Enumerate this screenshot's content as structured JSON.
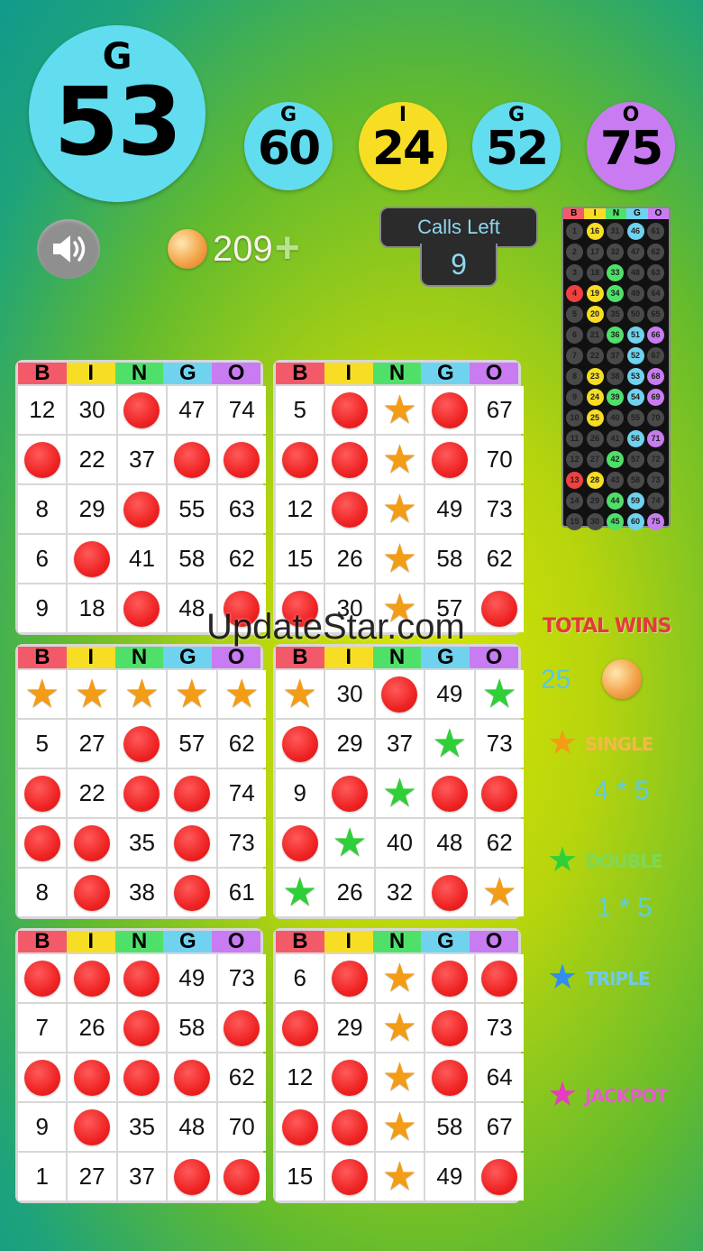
{
  "current_call": {
    "letter": "G",
    "number": "53",
    "color": "#62ddf0"
  },
  "previous_calls": [
    {
      "letter": "G",
      "number": "60",
      "color": "#62ddf0"
    },
    {
      "letter": "I",
      "number": "24",
      "color": "#f7de25"
    },
    {
      "letter": "G",
      "number": "52",
      "color": "#62ddf0"
    },
    {
      "letter": "O",
      "number": "75",
      "color": "#c97cf2"
    }
  ],
  "coins": {
    "count": "209",
    "add_symbol": "+"
  },
  "calls_left": {
    "label": "Calls Left",
    "value": "9"
  },
  "column_letters": [
    "B",
    "I",
    "N",
    "G",
    "O"
  ],
  "column_colors": [
    "#f25a6a",
    "#f7de25",
    "#4fe06a",
    "#6fd3ef",
    "#c97cf2"
  ],
  "tracker": {
    "header": [
      "B",
      "I",
      "N",
      "G",
      "O"
    ],
    "called": {
      "1": "#4a4a4a",
      "4": "#f04040",
      "13": "#f04040",
      "16": "#f7de25",
      "19": "#f7de25",
      "20": "#f7de25",
      "23": "#f7de25",
      "24": "#f7de25",
      "25": "#f7de25",
      "28": "#f7de25",
      "33": "#4fe06a",
      "34": "#4fe06a",
      "36": "#4fe06a",
      "39": "#4fe06a",
      "42": "#4fe06a",
      "44": "#4fe06a",
      "45": "#4fe06a",
      "46": "#6fd3ef",
      "51": "#6fd3ef",
      "52": "#6fd3ef",
      "53": "#6fd3ef",
      "54": "#6fd3ef",
      "56": "#6fd3ef",
      "59": "#6fd3ef",
      "60": "#6fd3ef",
      "66": "#c97cf2",
      "68": "#c97cf2",
      "69": "#c97cf2",
      "71": "#c97cf2",
      "75": "#c97cf2"
    }
  },
  "cards": [
    {
      "cells": [
        [
          "12",
          "30",
          "dot",
          "47",
          "74"
        ],
        [
          "dot",
          "22",
          "37",
          "dot",
          "dot"
        ],
        [
          "8",
          "29",
          "dot",
          "55",
          "63"
        ],
        [
          "6",
          "dot",
          "41",
          "58",
          "62"
        ],
        [
          "9",
          "18",
          "dot",
          "48",
          "dot"
        ]
      ]
    },
    {
      "cells": [
        [
          "5",
          "dot",
          "star",
          "dot",
          "67"
        ],
        [
          "dot",
          "dot",
          "star",
          "dot",
          "70"
        ],
        [
          "12",
          "dot",
          "star",
          "49",
          "73"
        ],
        [
          "15",
          "26",
          "star",
          "58",
          "62"
        ],
        [
          "dot",
          "30",
          "star",
          "57",
          "dot"
        ]
      ]
    },
    {
      "cells": [
        [
          "star",
          "star",
          "star",
          "star",
          "star"
        ],
        [
          "5",
          "27",
          "dot",
          "57",
          "62"
        ],
        [
          "dot",
          "22",
          "dot",
          "dot",
          "74"
        ],
        [
          "dot",
          "dot",
          "35",
          "dot",
          "73"
        ],
        [
          "8",
          "dot",
          "38",
          "dot",
          "61"
        ]
      ]
    },
    {
      "cells": [
        [
          "star",
          "30",
          "dot",
          "49",
          "gstar"
        ],
        [
          "dot",
          "29",
          "37",
          "gstar",
          "73"
        ],
        [
          "9",
          "dot",
          "gstar",
          "dot",
          "dot"
        ],
        [
          "dot",
          "gstar",
          "40",
          "48",
          "62"
        ],
        [
          "gstar",
          "26",
          "32",
          "dot",
          "star"
        ]
      ]
    },
    {
      "cells": [
        [
          "dot",
          "dot",
          "dot",
          "49",
          "73"
        ],
        [
          "7",
          "26",
          "dot",
          "58",
          "dot"
        ],
        [
          "dot",
          "dot",
          "dot",
          "dot",
          "62"
        ],
        [
          "9",
          "dot",
          "35",
          "48",
          "70"
        ],
        [
          "1",
          "27",
          "37",
          "dot",
          "dot"
        ]
      ]
    },
    {
      "cells": [
        [
          "6",
          "dot",
          "star",
          "dot",
          "dot"
        ],
        [
          "dot",
          "29",
          "star",
          "dot",
          "73"
        ],
        [
          "12",
          "dot",
          "star",
          "dot",
          "64"
        ],
        [
          "dot",
          "dot",
          "star",
          "58",
          "67"
        ],
        [
          "15",
          "dot",
          "star",
          "49",
          "dot"
        ]
      ]
    }
  ],
  "watermark": "UpdateStar.com",
  "total_wins": {
    "label": "TOTAL WINS",
    "count": "25"
  },
  "prizes": [
    {
      "label": "SINGLE",
      "value": "4 * 5",
      "star_color": "#f39c15",
      "label_color": "#f5b74a"
    },
    {
      "label": "DOUBLE",
      "value": "1 * 5",
      "star_color": "#2fcf38",
      "label_color": "#7ed957"
    },
    {
      "label": "TRIPLE",
      "value": "",
      "star_color": "#2f8ef0",
      "label_color": "#6ec9ef"
    },
    {
      "label": "JACKPOT",
      "value": "",
      "star_color": "#e83bc0",
      "label_color": "#e65bd0"
    }
  ]
}
